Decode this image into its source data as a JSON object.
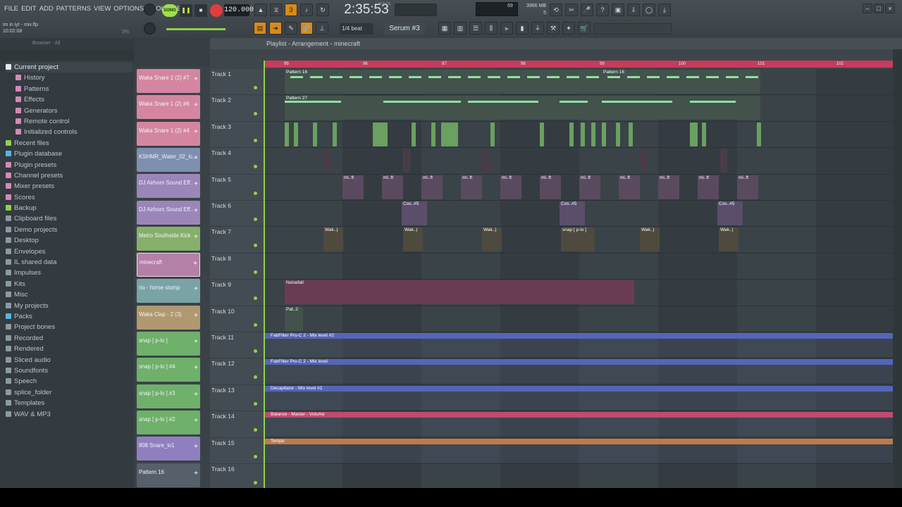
{
  "menu": [
    "FILE",
    "EDIT",
    "ADD",
    "PATTERNS",
    "VIEW",
    "OPTIONS",
    "TOOLS",
    "HELP"
  ],
  "project": {
    "file": "im in iyt - mix.flp",
    "time": "10:02:08",
    "cpu_pct": "3%"
  },
  "transport": {
    "song_label": "SONG",
    "tempo": "120.000",
    "clock": "2:35:53",
    "clock_unit": "M:S:CS",
    "cpu": "69",
    "memory": "3966 MB",
    "polyphony": "5"
  },
  "toolbar2": {
    "snap": "1/4 beat",
    "pattern": "Serum #3"
  },
  "browser": {
    "title": "Browser - All",
    "items": [
      {
        "label": "Current project",
        "level": "top",
        "color": "#e8ecef"
      },
      {
        "label": "History",
        "level": "sub",
        "color": "#d48ab8"
      },
      {
        "label": "Patterns",
        "level": "sub",
        "color": "#d48ab8"
      },
      {
        "label": "Effects",
        "level": "sub",
        "color": "#d48ab8"
      },
      {
        "label": "Generators",
        "level": "sub",
        "color": "#d48ab8"
      },
      {
        "label": "Remote control",
        "level": "sub",
        "color": "#d48ab8"
      },
      {
        "label": "Initialized controls",
        "level": "sub",
        "color": "#d48ab8"
      },
      {
        "label": "Recent files",
        "level": "root",
        "color": "#8fd24a"
      },
      {
        "label": "Plugin database",
        "level": "root",
        "color": "#5bb3e0"
      },
      {
        "label": "Plugin presets",
        "level": "root",
        "color": "#d48ab8"
      },
      {
        "label": "Channel presets",
        "level": "root",
        "color": "#d48ab8"
      },
      {
        "label": "Mixer presets",
        "level": "root",
        "color": "#d48ab8"
      },
      {
        "label": "Scores",
        "level": "root",
        "color": "#d48ab8"
      },
      {
        "label": "Backup",
        "level": "root",
        "color": "#8fd24a"
      },
      {
        "label": "Clipboard files",
        "level": "root",
        "color": "#8b9aa3"
      },
      {
        "label": "Demo projects",
        "level": "root",
        "color": "#8b9aa3"
      },
      {
        "label": "Desktop",
        "level": "root",
        "color": "#8b9aa3"
      },
      {
        "label": "Envelopes",
        "level": "root",
        "color": "#8b9aa3"
      },
      {
        "label": "IL shared data",
        "level": "root",
        "color": "#8b9aa3"
      },
      {
        "label": "Impulses",
        "level": "root",
        "color": "#8b9aa3"
      },
      {
        "label": "Kits",
        "level": "root",
        "color": "#8b9aa3"
      },
      {
        "label": "Misc",
        "level": "root",
        "color": "#8b9aa3"
      },
      {
        "label": "My projects",
        "level": "root",
        "color": "#8b9aa3"
      },
      {
        "label": "Packs",
        "level": "root",
        "color": "#5bb3e0"
      },
      {
        "label": "Project bones",
        "level": "root",
        "color": "#8b9aa3"
      },
      {
        "label": "Recorded",
        "level": "root",
        "color": "#8b9aa3"
      },
      {
        "label": "Rendered",
        "level": "root",
        "color": "#8b9aa3"
      },
      {
        "label": "Sliced audio",
        "level": "root",
        "color": "#8b9aa3"
      },
      {
        "label": "Soundfonts",
        "level": "root",
        "color": "#8b9aa3"
      },
      {
        "label": "Speech",
        "level": "root",
        "color": "#8b9aa3"
      },
      {
        "label": "splice_folder",
        "level": "root",
        "color": "#8b9aa3"
      },
      {
        "label": "Templates",
        "level": "root",
        "color": "#8b9aa3"
      },
      {
        "label": "WAV & MP3",
        "level": "root",
        "color": "#8b9aa3"
      }
    ]
  },
  "channels": [
    {
      "name": "Waka Snare 1 (2) #7",
      "color": "#d486a1"
    },
    {
      "name": "Waka Snare 1 (2) #6",
      "color": "#d486a1"
    },
    {
      "name": "Waka Snare 1 (2) #4",
      "color": "#d486a1"
    },
    {
      "name": "KSHMR_Water_02_Ic..",
      "color": "#7f8fb0"
    },
    {
      "name": "DJ Airhorn Sound Eff..",
      "color": "#9a86b8"
    },
    {
      "name": "DJ Airhorn Sound Eff..",
      "color": "#9a86b8"
    },
    {
      "name": "Metro Southside Kick",
      "color": "#85b06a"
    },
    {
      "name": "minecraft",
      "color": "#b580a8"
    },
    {
      "name": "rio - horse stomp",
      "color": "#7aa3a8"
    },
    {
      "name": "Waka Clap - 2 (3)",
      "color": "#b09870"
    },
    {
      "name": "snap [ p-lo ]",
      "color": "#6fb06a"
    },
    {
      "name": "snap [ p-lo ] #4",
      "color": "#6fb06a"
    },
    {
      "name": "snap [ p-lo ] #3",
      "color": "#6fb06a"
    },
    {
      "name": "snap [ p-lo ] #2",
      "color": "#6fb06a"
    },
    {
      "name": "808 Snare_lo1",
      "color": "#8f7fc0"
    },
    {
      "name": "Pattern 16",
      "color": "#56606a"
    }
  ],
  "playlist": {
    "title": "Playlist - Arrangement - minecraft",
    "ruler_ticks": [
      "95",
      "96",
      "97",
      "98",
      "99",
      "100",
      "101",
      "102"
    ],
    "tracks": [
      "Track 1",
      "Track 2",
      "Track 3",
      "Track 4",
      "Track 5",
      "Track 6",
      "Track 7",
      "Track 8",
      "Track 9",
      "Track 10",
      "Track 11",
      "Track 12",
      "Track 13",
      "Track 14",
      "Track 15",
      "Track 16"
    ],
    "pattern_labels": {
      "p16a": "Pattern 16",
      "p16b": "Pattern 16",
      "p27": "Pattern 27",
      "p2": "Pat..2"
    },
    "audio_labels": {
      "mi": "mi..ft",
      "cos": "Cos..#5",
      "wak": "Wak..)",
      "snap": "snap [ p-lo ]",
      "noise": "Noisefall"
    },
    "automation": [
      {
        "label": "FabFilter Pro-C 2 - Mix level #2",
        "color": "#5565b8"
      },
      {
        "label": "FabFilter Pro-C 2 - Mix level",
        "color": "#5565b8"
      },
      {
        "label": "Decapitator - Mix level #2",
        "color": "#5565b8"
      },
      {
        "label": "Balance - Master - Volume",
        "color": "#c04a72"
      },
      {
        "label": "Tempo",
        "color": "#c07a4a"
      }
    ]
  }
}
